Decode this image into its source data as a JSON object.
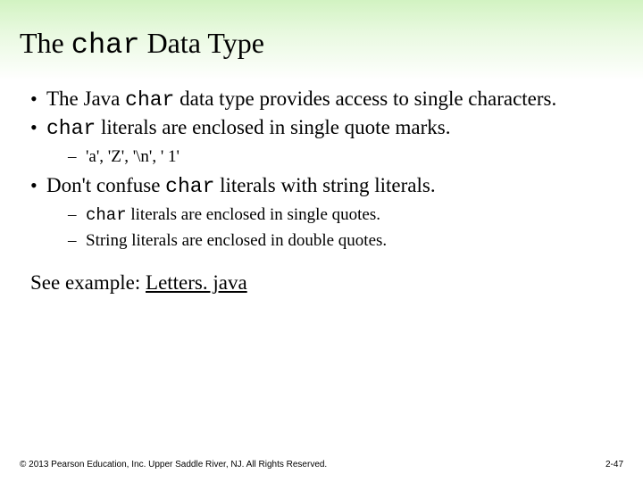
{
  "title": {
    "pre": "The ",
    "code": "char",
    "post": " Data Type"
  },
  "bullets": {
    "b1": {
      "pre": "The Java ",
      "code": "char",
      "post": " data type provides access to single characters."
    },
    "b2": {
      "code": "char",
      "post": " literals are enclosed in single quote marks.",
      "sub1": "'a', 'Z', '\\n', ' 1'"
    },
    "b3": {
      "pre": "Don't confuse ",
      "code": "char",
      "post": " literals with string literals.",
      "sub1_code": "char",
      "sub1_post": " literals are enclosed in single quotes.",
      "sub2": "String literals are enclosed in double quotes."
    }
  },
  "see_example": {
    "label": "See example: ",
    "link": "Letters. java"
  },
  "footer": {
    "copyright": "© 2013 Pearson Education, Inc. Upper Saddle River, NJ. All Rights Reserved.",
    "page": "2-47"
  }
}
